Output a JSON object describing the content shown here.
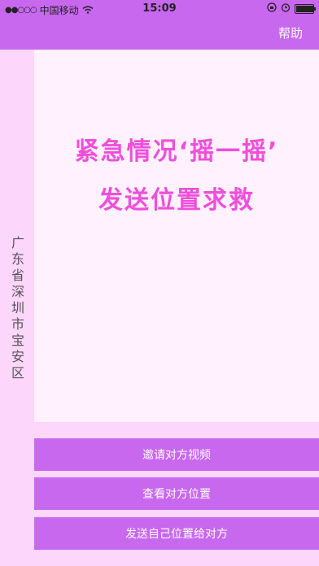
{
  "status_bar": {
    "carrier": "中国移动",
    "time": "15:09"
  },
  "header": {
    "help_label": "帮助"
  },
  "location": {
    "text": "广东省深圳市宝安区"
  },
  "main": {
    "slogan_line1": "紧急情况‘摇一摇’",
    "slogan_line2": "发送位置求救"
  },
  "buttons": {
    "video_invite": "邀请对方视频",
    "view_location": "查看对方位置",
    "send_location": "发送自己位置给对方"
  },
  "colors": {
    "accent": "#c768ee",
    "slogan": "#ee4fda",
    "background": "#fdd6fb"
  }
}
